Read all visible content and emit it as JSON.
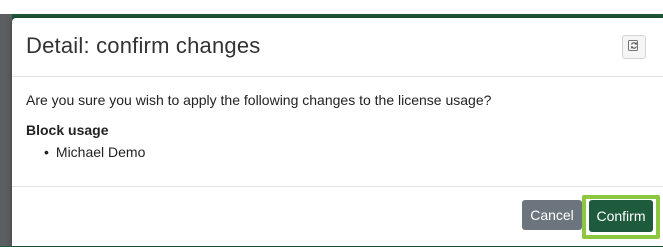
{
  "dialog": {
    "title": "Detail: confirm changes",
    "refresh_icon": "refresh-icon",
    "question": "Are you sure you wish to apply the following changes to the license usage?",
    "section_title": "Block usage",
    "items": [
      {
        "bullet": "•",
        "label": "Michael Demo"
      }
    ]
  },
  "footer": {
    "cancel_label": "Cancel",
    "confirm_label": "Confirm"
  },
  "colors": {
    "primary": "#1e5b3c",
    "secondary": "#6c757d",
    "highlight": "#8dc63f"
  }
}
